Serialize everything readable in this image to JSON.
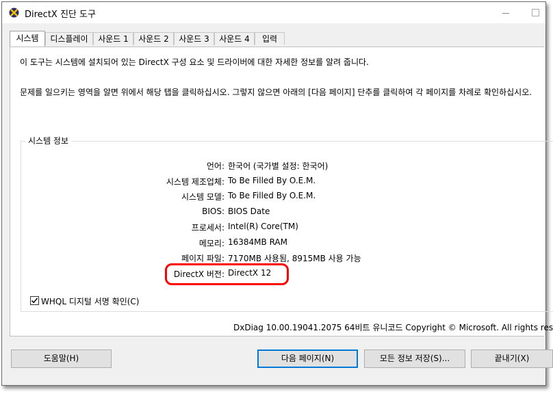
{
  "window": {
    "title": "DirectX 진단 도구"
  },
  "tabs": [
    {
      "label": "시스템"
    },
    {
      "label": "디스플레이"
    },
    {
      "label": "사운드 1"
    },
    {
      "label": "사운드 2"
    },
    {
      "label": "사운드 3"
    },
    {
      "label": "사운드 4"
    },
    {
      "label": "입력"
    }
  ],
  "intro": {
    "line1": "이 도구는 시스템에 설치되어 있는 DirectX 구성 요소 및 드라이버에 대한 자세한 정보를 알려 줍니다.",
    "line2": "문제를 일으키는 영역을 알면 위에서 해당 탭을 클릭하십시오. 그렇지 않으면 아래의 [다음 페이지] 단추를 클릭하여 각 페이지를 차례로 확인하십시오."
  },
  "system_info": {
    "title": "시스템 정보",
    "rows": [
      {
        "label": "언어:",
        "value": "한국어 (국가별 설정: 한국어)"
      },
      {
        "label": "시스템 제조업체:",
        "value": "To Be Filled By O.E.M."
      },
      {
        "label": "시스템 모델:",
        "value": "To Be Filled By O.E.M."
      },
      {
        "label": "BIOS:",
        "value": "BIOS Date"
      },
      {
        "label": "프로세서:",
        "value": "Intel(R) Core(TM)"
      },
      {
        "label": "메모리:",
        "value": "16384MB RAM"
      },
      {
        "label": "페이지 파일:",
        "value": "7170MB 사용됨, 8915MB 사용 가능"
      },
      {
        "label": "DirectX 버전:",
        "value": "DirectX 12"
      }
    ]
  },
  "whql": {
    "label": "WHQL 디지털 서명 확인(C)",
    "checked": true
  },
  "footer_info": "DxDiag 10.00.19041.2075 64비트 유니코드  Copyright © Microsoft. All rights reser",
  "buttons": {
    "help": "도움말(H)",
    "next": "다음 페이지(N)",
    "save": "모든 정보 저장(S)...",
    "exit": "끝내기(X)"
  },
  "colors": {
    "highlight": "#ff0000",
    "accent": "#0078d7"
  },
  "icons": {
    "app": "directx-x-icon",
    "check": "checkmark-icon"
  }
}
